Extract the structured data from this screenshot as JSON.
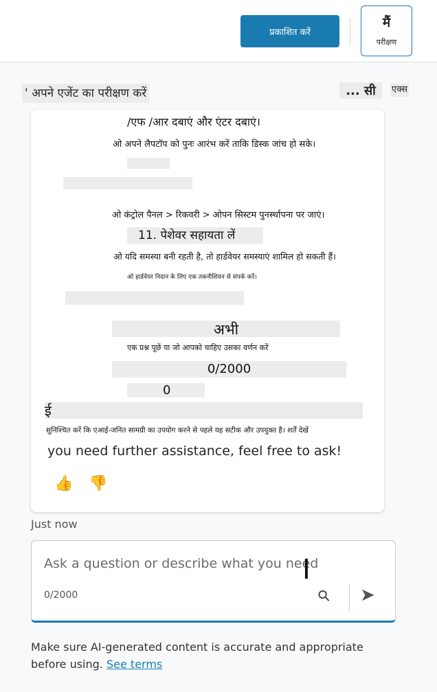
{
  "header": {
    "publish_label": "प्रकाशित करें",
    "test_glyph": "मैं",
    "test_label": "परीक्षण"
  },
  "panel": {
    "title": "' अपने एजेंट का परीक्षण करें",
    "more_label": "... सी",
    "x_label": "एक्स"
  },
  "message": {
    "lines": [
      "/एफ /आर दबाएं और एंटर दबाएं।",
      "ओ अपने लैपटॉप को पुनः आरंभ करें ताकि डिस्क जांच हो सके।",
      "ओ कंट्रोल पैनल > रिकवरी > ओपन सिस्टम पुनर्स्थापना पर जाएं।",
      "11. पेशेवर सहायता लें",
      "ओ यदि समस्या बनी रहती है, तो हार्डवेयर समस्याएं शामिल हो सकती हैं।",
      "ओ हार्डवेयर निदान के लिए एक तकनीशियन से संपर्क करें।",
      "अभी",
      "एक प्रश्न पूछें या जो आपको चाहिए उसका वर्णन करें",
      "0/2000",
      "0",
      "ई",
      "सुनिश्चित करें कि एआई-जनित सामग्री का उपयोग करने से पहले यह सटीक और उपयुक्त है। शर्तें देखें"
    ],
    "english_line": "you need further assistance, feel free to ask!",
    "like_icon": "👍",
    "dislike_icon": "👎"
  },
  "timestamp": "Just now",
  "composer": {
    "placeholder": "Ask a question or describe what you need",
    "counter": "0/2000",
    "attach_icon": "paperclip-icon",
    "send_icon": "send-icon"
  },
  "footer": {
    "disclaimer": "Make sure AI-generated content is accurate and appropriate before using.",
    "terms_link": "See terms"
  }
}
